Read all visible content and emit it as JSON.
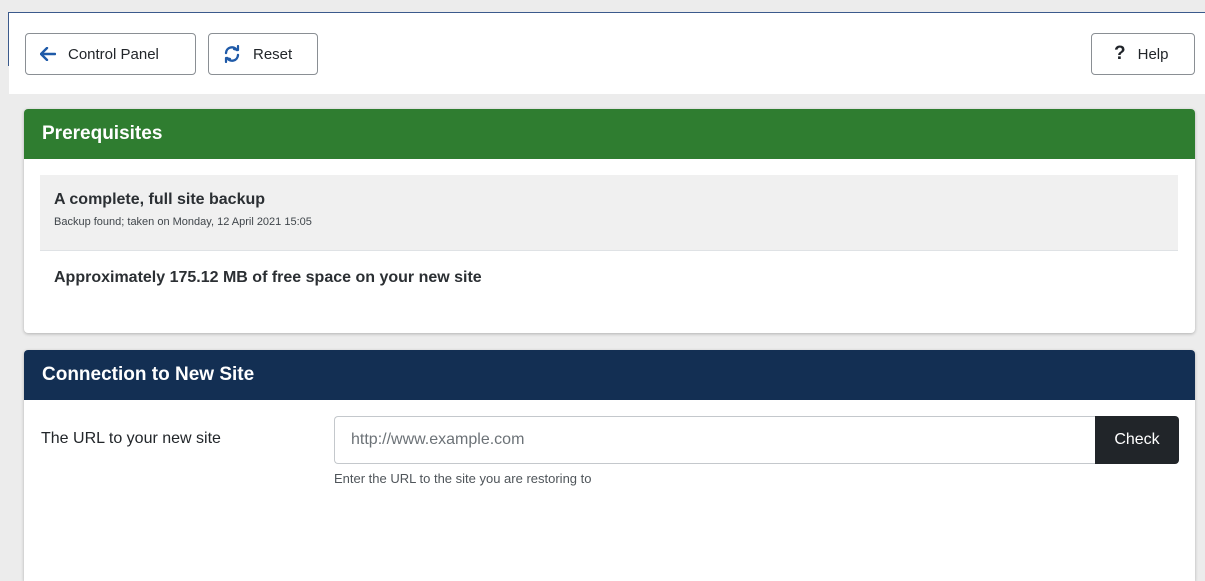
{
  "toolbar": {
    "control_panel_label": "Control Panel",
    "reset_label": "Reset",
    "help_label": "Help",
    "help_glyph": "?",
    "icons": {
      "control_panel": "arrow-left-icon",
      "reset": "refresh-icon",
      "help": "question-icon"
    },
    "colors": {
      "arrow_icon": "#1f5aa8",
      "reset_icon": "#1f5aa8"
    }
  },
  "prerequisites": {
    "title": "Prerequisites",
    "header_color": "#2f7d30",
    "items": [
      {
        "title": "A complete, full site backup",
        "subtitle": "Backup found; taken on Monday, 12 April 2021 15:05"
      },
      {
        "title": "Approximately 175.12 MB of free space on your new site"
      }
    ]
  },
  "connection": {
    "title": "Connection to New Site",
    "header_color": "#132f53",
    "url_label": "The URL to your new site",
    "url_placeholder": "http://www.example.com",
    "url_value": "",
    "check_label": "Check",
    "help_text": "Enter the URL to the site you are restoring to"
  }
}
